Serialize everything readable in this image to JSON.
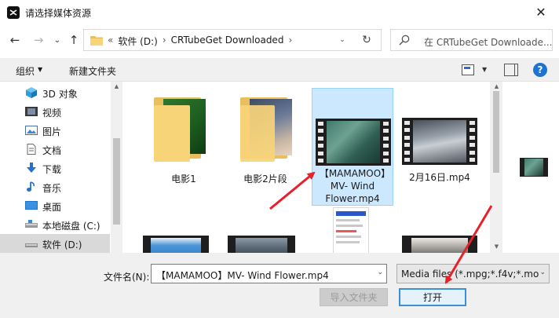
{
  "window": {
    "title": "请选择媒体资源",
    "close_glyph": "✕"
  },
  "nav_buttons": {
    "back": "←",
    "forward": "→",
    "dropdown": "⌄",
    "up": "↑"
  },
  "address": {
    "overflow": "«",
    "segments": [
      "软件 (D:)",
      "›",
      "CRTubeGet Downloaded",
      "›"
    ],
    "refresh_glyph": "↻",
    "dropdown_glyph": "⌄"
  },
  "search": {
    "placeholder": "在 CRTubeGet Downloade..."
  },
  "toolbar": {
    "organize": "组织",
    "organize_arrow": "▼",
    "new_folder": "新建文件夹",
    "view_arrow": "▼",
    "help": "?"
  },
  "sidebar": {
    "items": [
      {
        "label": "3D 对象",
        "icon": "cube-3d-icon"
      },
      {
        "label": "视频",
        "icon": "video-icon"
      },
      {
        "label": "图片",
        "icon": "picture-icon"
      },
      {
        "label": "文档",
        "icon": "document-icon"
      },
      {
        "label": "下载",
        "icon": "download-icon"
      },
      {
        "label": "音乐",
        "icon": "music-icon"
      },
      {
        "label": "桌面",
        "icon": "desktop-icon"
      },
      {
        "label": "本地磁盘 (C:)",
        "icon": "drive-icon"
      },
      {
        "label": "软件 (D:)",
        "icon": "drive-icon",
        "selected": true
      }
    ]
  },
  "files": [
    {
      "name": "电影1",
      "type": "folder"
    },
    {
      "name": "电影2片段",
      "type": "folder"
    },
    {
      "name": "【MAMAMOO】MV- Wind Flower.mp4",
      "type": "video",
      "selected": true
    },
    {
      "name": "2月16日.mp4",
      "type": "video"
    }
  ],
  "footer": {
    "filename_label": "文件名(N):",
    "filename_value": "【MAMAMOO】MV- Wind Flower.mp4",
    "filetype_value": "Media files (*.mpg;*.f4v;*.mo",
    "dropdown_glyph": "⌄",
    "import_folder_button": "导入文件夹",
    "open_button": "打开"
  },
  "colors": {
    "accent": "#1e73d2",
    "selection": "#cce8ff",
    "annotation_arrow": "#e8202a",
    "folder": "#f7d478"
  }
}
